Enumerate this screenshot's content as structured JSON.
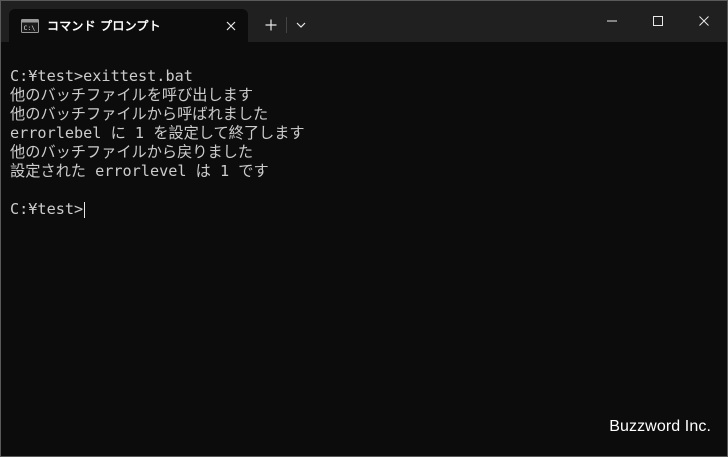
{
  "window": {
    "tab_title": "コマンド プロンプト",
    "icons": {
      "tab": "cmd-terminal-icon",
      "close_tab": "close-icon",
      "new_tab": "plus-icon",
      "dropdown": "chevron-down-icon",
      "minimize": "minimize-icon",
      "maximize": "maximize-icon",
      "close_window": "close-icon"
    },
    "colors": {
      "titlebar": "#202020",
      "terminal_bg": "#0c0c0c",
      "terminal_text": "#cccccc"
    }
  },
  "terminal": {
    "lines": [
      "C:¥test>exittest.bat",
      "他のバッチファイルを呼び出します",
      "他のバッチファイルから呼ばれました",
      "errorlebel に 1 を設定して終了します",
      "他のバッチファイルから戻りました",
      "設定された errorlevel は 1 です",
      ""
    ],
    "prompt": "C:¥test>"
  },
  "watermark": "Buzzword Inc."
}
